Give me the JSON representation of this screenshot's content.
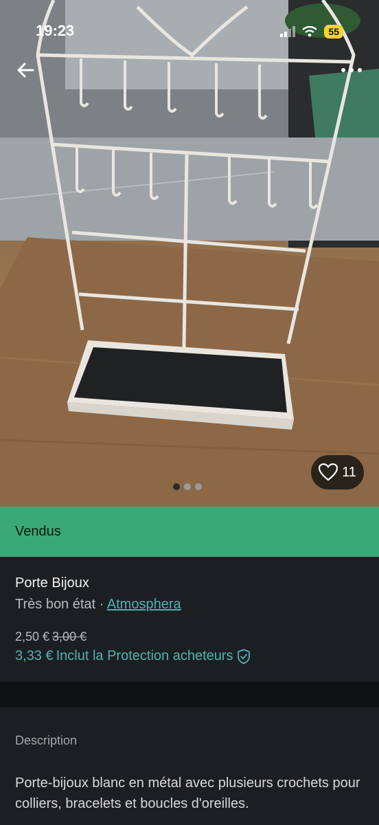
{
  "status": {
    "time": "19:23",
    "battery": "55"
  },
  "listing": {
    "like_count": "11",
    "sold_label": "Vendus",
    "title": "Porte Bijoux",
    "condition": "Très bon état",
    "separator": " · ",
    "brand": "Atmosphera",
    "price": "2,50 €",
    "old_price": "3,00 €",
    "buyer_price": "3,33 €",
    "buyer_protection": "Inclut la Protection acheteurs",
    "description_label": "Description",
    "description": "Porte-bijoux blanc en métal avec plusieurs crochets pour colliers, bracelets et boucles d'oreilles."
  },
  "carousel": {
    "count": 3,
    "active_index": 0
  },
  "colors": {
    "sold_banner": "#3aa876",
    "link": "#4fb3b6",
    "background": "#1b1f21"
  },
  "icons": [
    "back-arrow-icon",
    "more-icon",
    "heart-icon",
    "shield-check-icon",
    "signal-icon",
    "wifi-icon"
  ]
}
